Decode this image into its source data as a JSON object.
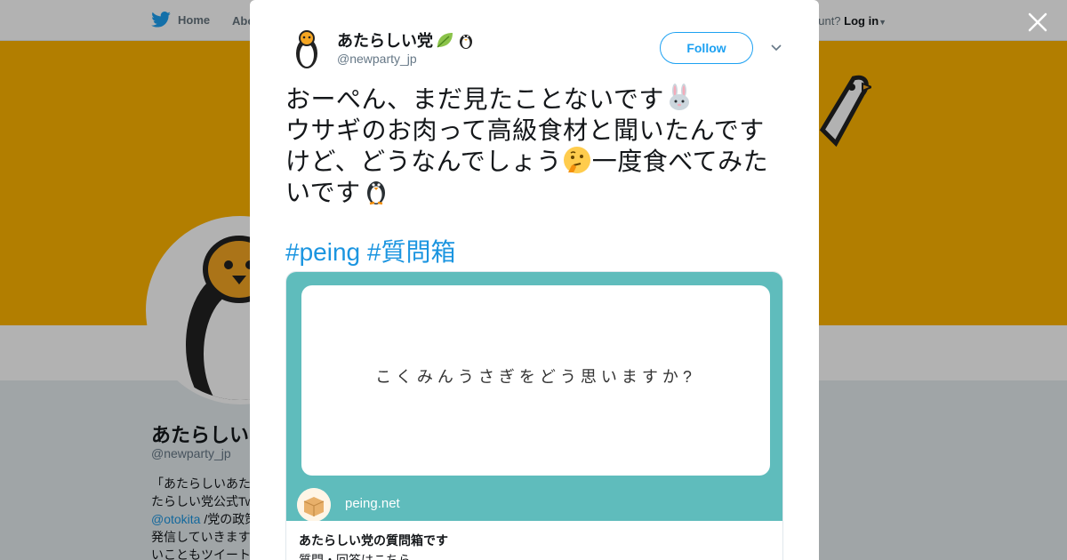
{
  "background": {
    "nav": {
      "home": "Home",
      "about": "Abo",
      "account_prefix": "ccount?",
      "login": "Log in"
    },
    "profile": {
      "name": "あたらしい",
      "handle": "@newparty_jp",
      "bio_lines": [
        "「あたらしいあた",
        "たらしい党公式Tw",
        "@otokita",
        "/党の政策",
        "発信していきます",
        "いこともツイート"
      ]
    },
    "colors": {
      "banner": "#ffb500",
      "page": "#e6ecf0"
    }
  },
  "tweet": {
    "name": "あたらしい党",
    "handle": "@newparty_jp",
    "follow_label": "Follow",
    "text_segments": [
      "おーぺん、まだ見たことないです",
      "ウサギのお肉って高級食材と聞いたんですけど、どうなんでしょう",
      "一度食べてみたいです"
    ],
    "emojis": [
      "rabbit-emoji",
      "thinking-face-emoji",
      "penguin-emoji"
    ],
    "hashtags": [
      "#peing",
      "#質問箱"
    ],
    "card": {
      "question": "こくみんうさぎをどう思いますか?",
      "domain": "peing.net",
      "title": "あたらしい党の質問箱です",
      "description": "質問・回答はこちら"
    },
    "colors": {
      "accent": "#1da1f2",
      "link": "#1b95e0",
      "card_bg": "#5fbcbc"
    }
  }
}
